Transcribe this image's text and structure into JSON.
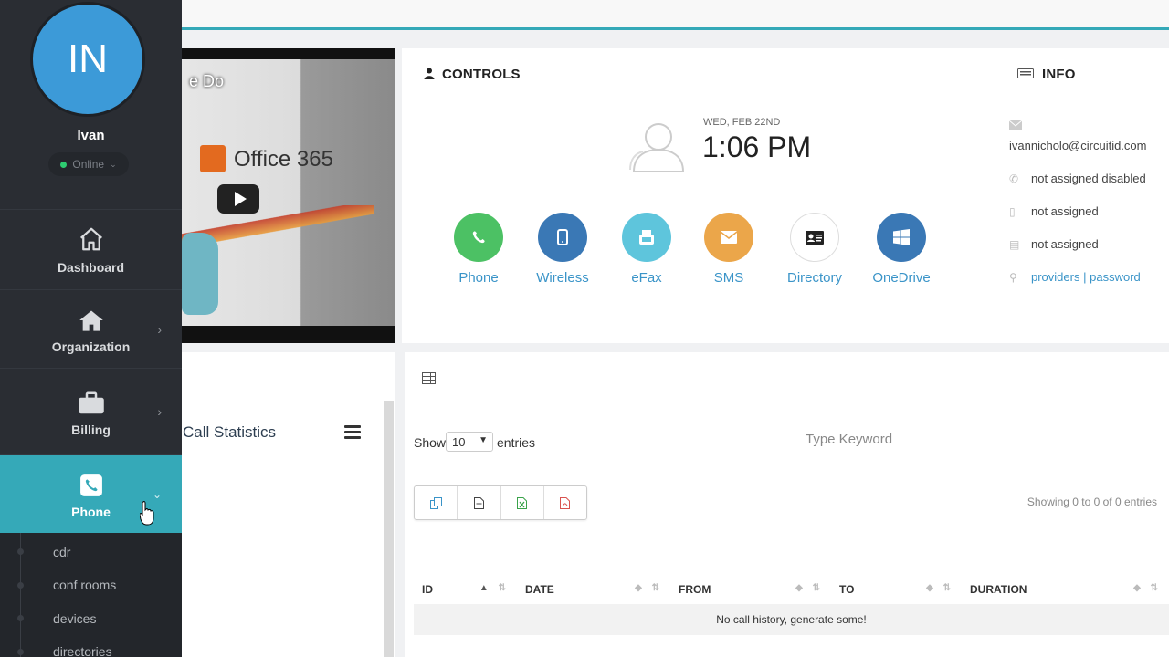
{
  "sidebar": {
    "avatar_initials": "IN",
    "user_name": "Ivan",
    "status": "Online",
    "nav": [
      {
        "label": "Dashboard",
        "icon": "home-outline-icon"
      },
      {
        "label": "Organization",
        "icon": "home-icon"
      },
      {
        "label": "Billing",
        "icon": "briefcase-icon"
      },
      {
        "label": "Phone",
        "icon": "phone-icon"
      }
    ],
    "phone_submenu": [
      "cdr",
      "conf rooms",
      "devices",
      "directories"
    ]
  },
  "video": {
    "title_fragment": "e Do",
    "logo_text": "Office 365"
  },
  "controls": {
    "title": "CONTROLS",
    "date": "WED, FEB 22ND",
    "time": "1:06 PM",
    "buttons": [
      {
        "label": "Phone",
        "color": "#4cc164",
        "icon": "phone-icon"
      },
      {
        "label": "Wireless",
        "color": "#3a78b5",
        "icon": "mobile-icon"
      },
      {
        "label": "eFax",
        "color": "#5ec5dc",
        "icon": "fax-icon"
      },
      {
        "label": "SMS",
        "color": "#eba64a",
        "icon": "envelope-icon"
      },
      {
        "label": "Directory",
        "color": "#ffffff",
        "icon": "contact-card-icon"
      },
      {
        "label": "OneDrive",
        "color": "#3a78b5",
        "icon": "windows-icon"
      }
    ]
  },
  "info": {
    "title": "INFO",
    "email": "ivannicholo@circuitid.com",
    "phone": "not assigned disabled",
    "mobile": "not assigned",
    "fax": "not assigned",
    "providers_link": "providers",
    "separator": "|",
    "password_link": "password"
  },
  "stats": {
    "title": "Call Statistics"
  },
  "table": {
    "show_label": "Show",
    "length_value": "10",
    "entries_label": "entries",
    "search_placeholder": "Type Keyword",
    "showing_info": "Showing 0 to 0 of 0 entries",
    "columns": [
      "ID",
      "DATE",
      "FROM",
      "TO",
      "DURATION"
    ],
    "empty_message": "No call history, generate some!"
  },
  "colors": {
    "accent": "#35a9b8",
    "sidebar_bg": "#2a2d33",
    "link": "#3a94c8"
  }
}
